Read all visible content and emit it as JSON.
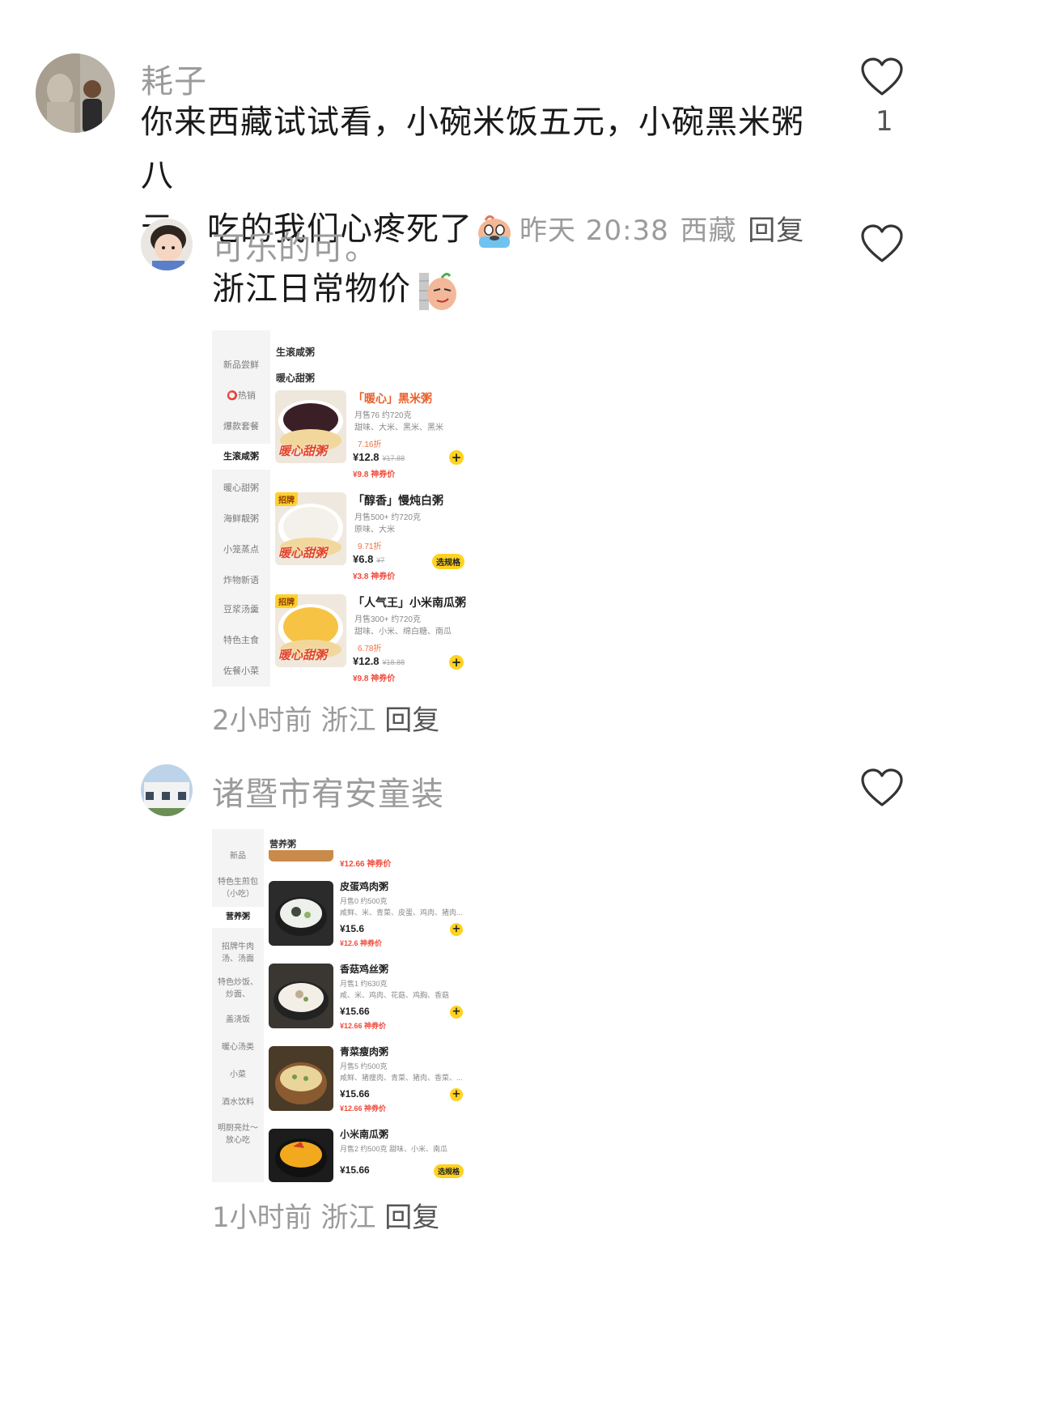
{
  "comments": [
    {
      "username": "耗子",
      "text_line1": "你来西藏试试看，小碗米饭五元，小碗黑米粥八",
      "text_line2": "元，吃的我们心疼死了",
      "time": "昨天 20:38",
      "location": "西藏",
      "reply": "回复",
      "likes": "1"
    },
    {
      "username": "可乐的可。",
      "text": "浙江日常物价",
      "time": "2小时前",
      "location": "浙江",
      "reply": "回复",
      "shot": {
        "sidebar": [
          "新品尝鲜",
          "热销",
          "爆款套餐",
          "生滚咸粥",
          "暖心甜粥",
          "海鲜靓粥",
          "小笼蒸点",
          "炸物新语",
          "豆浆汤羹",
          "特色主食",
          "佐餐小菜"
        ],
        "cat1": "生滚咸粥",
        "cat2": "暖心甜粥",
        "overlay": "暖心甜粥",
        "items": [
          {
            "title": "「暖心」黑米粥",
            "sold": "月售76  约720克",
            "tags": "甜味、大米、黑米、黑米",
            "disc": "7.16折",
            "price": "¥12.8",
            "orig": "¥17.88",
            "coupon": "¥9.8 神券价",
            "action": "+"
          },
          {
            "badge": "招牌",
            "title": "「醇香」慢炖白粥",
            "sold": "月售500+  约720克",
            "tags": "原味、大米",
            "disc": "9.71折",
            "price": "¥6.8",
            "orig": "¥7",
            "coupon": "¥3.8 神券价",
            "action": "选规格"
          },
          {
            "badge": "招牌",
            "title": "「人气王」小米南瓜粥",
            "sold": "月售300+  约720克",
            "tags": "甜味、小米、绵白糖、南瓜",
            "disc": "6.78折",
            "price": "¥12.8",
            "orig": "¥18.88",
            "coupon": "¥9.8 神券价",
            "action": "+"
          }
        ]
      }
    },
    {
      "username": "诸暨市宥安童装",
      "time": "1小时前",
      "location": "浙江",
      "reply": "回复",
      "shot": {
        "sidebar": [
          "新品",
          "特色生煎包（小吃）",
          "营养粥",
          "招牌牛肉汤、汤面",
          "特色炒饭、炒面、",
          "盖浇饭",
          "暖心汤类",
          "小菜",
          "酒水饮料",
          "明厨亮灶～放心吃"
        ],
        "cat": "营养粥",
        "top_coupon": "¥12.66 神券价",
        "items": [
          {
            "title": "皮蛋鸡肉粥",
            "sold": "月售0  约500克",
            "tags": "咸鲜、米、青菜、皮蛋、鸡肉、猪肉...",
            "price": "¥15.6",
            "coupon": "¥12.6 神券价",
            "action": "+"
          },
          {
            "title": "香菇鸡丝粥",
            "sold": "月售1  约630克",
            "tags": "咸、米、鸡肉、花菇、鸡胸、香菇",
            "price": "¥15.66",
            "coupon": "¥12.66 神券价",
            "action": "+"
          },
          {
            "title": "青菜瘦肉粥",
            "sold": "月售5  约500克",
            "tags": "咸鲜、猪瘦肉、青菜、猪肉、香菜、...",
            "price": "¥15.66",
            "coupon": "¥12.66 神券价",
            "action": "+"
          },
          {
            "title": "小米南瓜粥",
            "sold": "月售2  约500克  甜味、小米、南瓜",
            "price": "¥15.66",
            "action": "选规格"
          }
        ]
      }
    }
  ],
  "colors": {
    "meta": "#9b9b9b",
    "accent_yellow": "#ffd21f",
    "price_red": "#f04b3c"
  },
  "icons": [
    "heart-icon",
    "crying-emoji",
    "smirk-emoji",
    "plus-icon"
  ]
}
